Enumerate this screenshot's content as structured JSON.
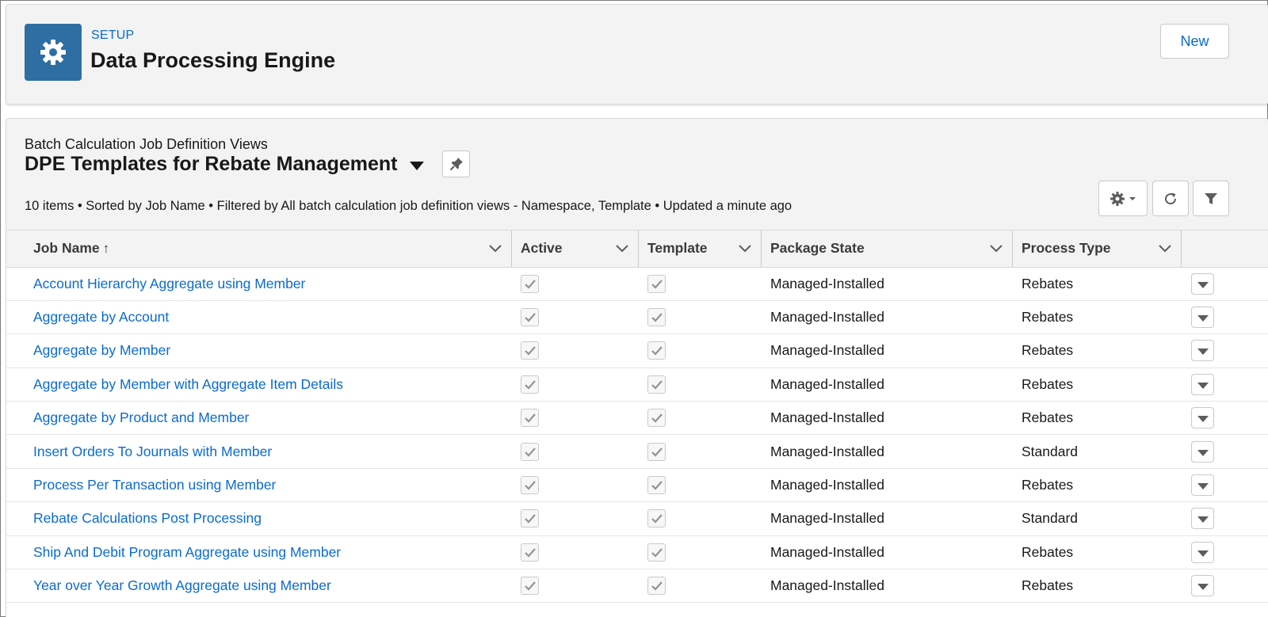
{
  "header": {
    "setup_label": "SETUP",
    "title": "Data Processing Engine",
    "new_button": "New",
    "icon": "gear-icon",
    "icon_bg": "#2e6ea3"
  },
  "list_view": {
    "object_label": "Batch Calculation Job Definition Views",
    "view_title": "DPE Templates for Rebate Management",
    "info": "10 items • Sorted by Job Name • Filtered by All batch calculation job definition views - Namespace, Template • Updated a minute ago",
    "columns": [
      {
        "label": "Job Name",
        "sort": "↑"
      },
      {
        "label": "Active"
      },
      {
        "label": "Template"
      },
      {
        "label": "Package State"
      },
      {
        "label": "Process Type"
      }
    ],
    "rows": [
      {
        "job_name": "Account Hierarchy Aggregate using Member",
        "active": true,
        "template": true,
        "package_state": "Managed-Installed",
        "process_type": "Rebates"
      },
      {
        "job_name": "Aggregate by Account",
        "active": true,
        "template": true,
        "package_state": "Managed-Installed",
        "process_type": "Rebates"
      },
      {
        "job_name": "Aggregate by Member",
        "active": true,
        "template": true,
        "package_state": "Managed-Installed",
        "process_type": "Rebates"
      },
      {
        "job_name": "Aggregate by Member with Aggregate Item Details",
        "active": true,
        "template": true,
        "package_state": "Managed-Installed",
        "process_type": "Rebates"
      },
      {
        "job_name": "Aggregate by Product and Member",
        "active": true,
        "template": true,
        "package_state": "Managed-Installed",
        "process_type": "Rebates"
      },
      {
        "job_name": "Insert Orders To Journals with Member",
        "active": true,
        "template": true,
        "package_state": "Managed-Installed",
        "process_type": "Standard"
      },
      {
        "job_name": "Process Per Transaction using Member",
        "active": true,
        "template": true,
        "package_state": "Managed-Installed",
        "process_type": "Rebates"
      },
      {
        "job_name": "Rebate Calculations Post Processing",
        "active": true,
        "template": true,
        "package_state": "Managed-Installed",
        "process_type": "Standard"
      },
      {
        "job_name": "Ship And Debit Program Aggregate using Member",
        "active": true,
        "template": true,
        "package_state": "Managed-Installed",
        "process_type": "Rebates"
      },
      {
        "job_name": "Year over Year Growth Aggregate using Member",
        "active": true,
        "template": true,
        "package_state": "Managed-Installed",
        "process_type": "Rebates"
      }
    ]
  },
  "colors": {
    "link": "#0b6bcb",
    "header_bg": "#f3f3f3",
    "border": "#c9c9c9"
  }
}
